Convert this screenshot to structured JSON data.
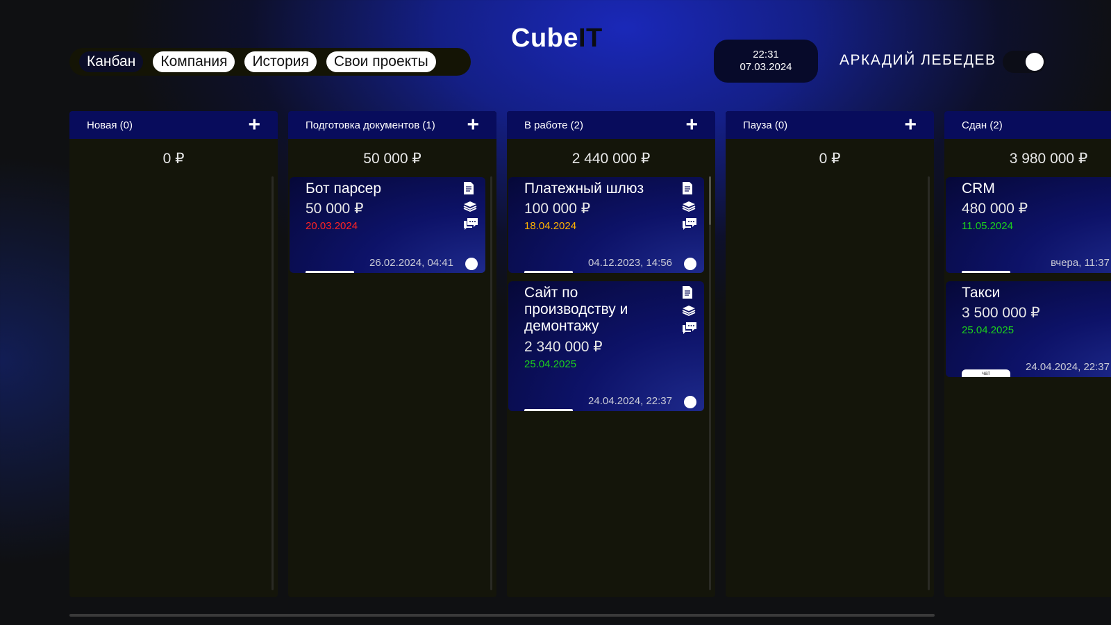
{
  "nav": {
    "items": [
      "Канбан",
      "Компания",
      "История",
      "Свои проекты"
    ],
    "active_index": 0
  },
  "logo": {
    "part1": "Cube",
    "part2": "IT"
  },
  "clock": {
    "time": "22:31",
    "date": "07.03.2024"
  },
  "user": {
    "name": "АРКАДИЙ ЛЕБЕДЕВ",
    "toggle_on": true
  },
  "columns": [
    {
      "title": "Новая (0)",
      "sum": "0 ₽",
      "cards": []
    },
    {
      "title": "Подготовка документов (1)",
      "sum": "50 000 ₽",
      "cards": [
        {
          "name": "Бот парсер",
          "price": "50 000 ₽",
          "deadline": "20.03.2024",
          "deadline_color": "red",
          "stamp": "26.02.2024, 04:41"
        }
      ]
    },
    {
      "title": "В работе (2)",
      "sum": "2 440 000 ₽",
      "cards": [
        {
          "name": "Платежный шлюз",
          "price": "100 000 ₽",
          "deadline": "18.04.2024",
          "deadline_color": "orange",
          "stamp": "04.12.2023, 14:56"
        },
        {
          "name": "Сайт по производству и демонтажу",
          "price": "2 340 000 ₽",
          "deadline": "25.04.2025",
          "deadline_color": "green",
          "stamp": "24.04.2024, 22:37"
        }
      ]
    },
    {
      "title": "Пауза (0)",
      "sum": "0 ₽",
      "cards": []
    },
    {
      "title": "Сдан  (2)",
      "sum": "3 980 000 ₽",
      "cards": [
        {
          "name": "CRM",
          "price": "480 000 ₽",
          "deadline": "11.05.2024",
          "deadline_color": "green",
          "stamp": "вчера, 11:37"
        },
        {
          "name": "Такси",
          "price": "3 500 000 ₽",
          "deadline": "25.04.2025",
          "deadline_color": "green",
          "stamp": "24.04.2024, 22:37",
          "tab_label": "чат"
        }
      ]
    }
  ],
  "icons": {
    "card": [
      "document-icon",
      "layers-icon",
      "chat-icon"
    ],
    "add": "plus-icon"
  },
  "colors": {
    "header": "#080c5c",
    "column_bg": "#14150a",
    "red": "#ff2323",
    "orange": "#ffb200",
    "green": "#1cd11c"
  }
}
